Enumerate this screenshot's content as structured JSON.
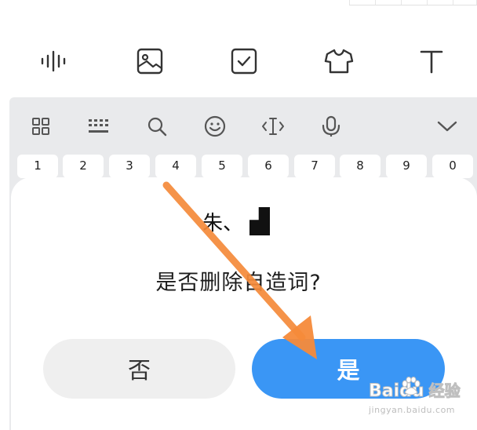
{
  "toolbar": {
    "icons": [
      "voice-wave-icon",
      "image-icon",
      "checkbox-icon",
      "tshirt-icon",
      "text-icon"
    ]
  },
  "keyboard": {
    "icons": [
      "grid-icon",
      "keyboard-icon",
      "search-icon",
      "emoji-icon",
      "cursor-icon",
      "microphone-icon",
      "chevron-down-icon"
    ],
    "number_keys": [
      "1",
      "2",
      "3",
      "4",
      "5",
      "6",
      "7",
      "8",
      "9",
      "0"
    ]
  },
  "dialog": {
    "word": "朱、",
    "question": "是否删除自造词?",
    "no_label": "否",
    "yes_label": "是"
  },
  "colors": {
    "accent": "#3a96f5",
    "arrow": "#f58a3a",
    "keyboard_bg": "#e9eaec"
  },
  "watermark": {
    "brand": "Baidu",
    "brand_cn": "经验",
    "url": "jingyan.baidu.com"
  }
}
